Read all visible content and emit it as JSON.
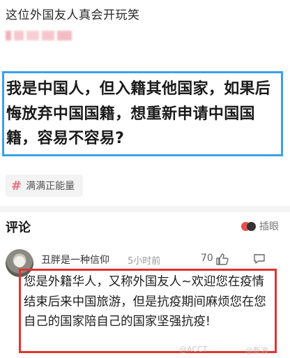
{
  "post": {
    "title": "这位外国友人真会开玩笑",
    "question": "我是中国人，但入籍其他国家，如果后悔放弃中国国籍，想重新申请中国国籍，容易不容易?",
    "topic_tag": "满满正能量"
  },
  "comments": {
    "heading": "评论",
    "insert_label": "插眼",
    "item": {
      "username": "丑胖是一种信仰",
      "time": "5小时前",
      "likes": "70",
      "text": "您是外籍华人，又称外国友人~欢迎您在疫情结束后来中国旅游，但是抗疫期间麻烦您在您自己的国家陪自己的国家坚强抗疫!"
    }
  },
  "watermarks": {
    "left": "@ACCT",
    "right": "@新浪"
  },
  "colors": {
    "question_border": "#3aa0e8",
    "reply_border": "#e0342e",
    "hash_accent": "#e8717a"
  }
}
